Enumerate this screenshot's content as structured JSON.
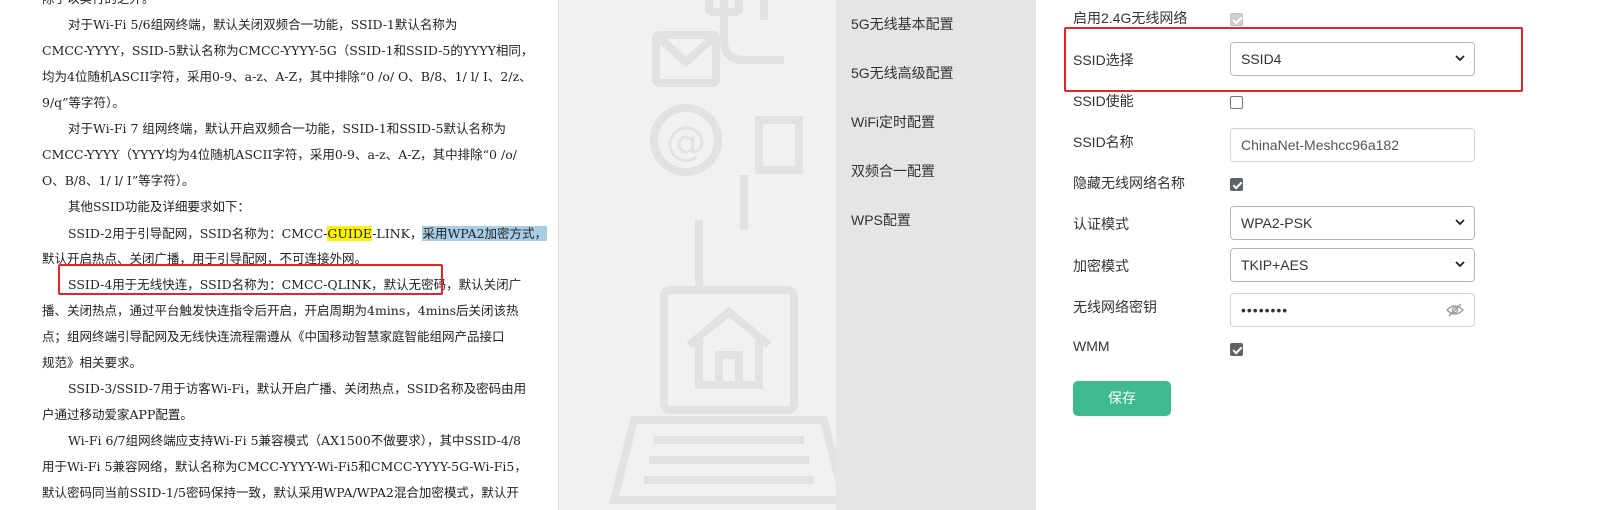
{
  "document": {
    "lines": [
      {
        "text": "除了以实行的之外。",
        "indent": false
      },
      {
        "text": "对于Wi-Fi 5/6组网终端，默认关闭双频合一功能，SSID-1默认名称为",
        "indent": true
      },
      {
        "text": "CMCC-YYYY，SSID-5默认名称为CMCC-YYYY-5G（SSID-1和SSID-5的YYYY相同，",
        "indent": false
      },
      {
        "text": "均为4位随机ASCII字符，采用0-9、a-z、A-Z，其中排除“0 /o/ O、B/8、1/ l/ I、2/z、",
        "indent": false
      },
      {
        "text": "9/q”等字符）。",
        "indent": false
      },
      {
        "text": "对于Wi-Fi 7 组网终端，默认开启双频合一功能，SSID-1和SSID-5默认名称为",
        "indent": true
      },
      {
        "text": "CMCC-YYYY（YYYY均为4位随机ASCII字符，采用0-9、a-z、A-Z，其中排除“0 /o/",
        "indent": false
      },
      {
        "text": "O、B/8、1/ l/ I”等字符）。",
        "indent": false
      },
      {
        "text": "其他SSID功能及详细要求如下：",
        "indent": true
      }
    ],
    "guide_line": {
      "prefix": "SSID-2用于引导配网，SSID名称为：CMCC-",
      "yellow": "GUIDE",
      "middle": "-LINK，",
      "blue": "采用WPA2加密方式，"
    },
    "guide_line2": "默认开启热点、关闭广播，用于引导配网，不可连接外网。",
    "qlink_line": "SSID-4用于无线快连，SSID名称为：CMCC-QLINK，默认无密码，默认关闭广",
    "lines2": [
      {
        "text": "播、关闭热点，通过平台触发快连指令后开启，开启周期为4mins，4mins后关闭该热",
        "indent": false
      },
      {
        "text": "点；组网终端引导配网及无线快连流程需遵从《中国移动智慧家庭智能组网产品接口",
        "indent": false
      },
      {
        "text": "规范》相关要求。",
        "indent": false
      },
      {
        "text": "SSID-3/SSID-7用于访客Wi-Fi，默认开启广播、关闭热点，SSID名称及密码由用",
        "indent": true
      },
      {
        "text": "户通过移动爱家APP配置。",
        "indent": false
      },
      {
        "text": "Wi-Fi 6/7组网终端应支持Wi-Fi 5兼容模式（AX1500不做要求），其中SSID-4/8",
        "indent": true
      },
      {
        "text": "用于Wi-Fi 5兼容网络，默认名称为CMCC-YYYY-Wi-Fi5和CMCC-YYYY-5G-Wi-Fi5，",
        "indent": false
      },
      {
        "text": "默认密码同当前SSID-1/5密码保持一致，默认采用WPA/WPA2混合加密模式，默认开",
        "indent": false
      }
    ]
  },
  "sidebar": {
    "items": [
      {
        "label": "5G无线基本配置"
      },
      {
        "label": "5G无线高级配置"
      },
      {
        "label": "WiFi定时配置"
      },
      {
        "label": "双频合一配置"
      },
      {
        "label": "WPS配置"
      }
    ]
  },
  "form": {
    "enable_24g": {
      "label": "启用2.4G无线网络",
      "checked": true,
      "disabled": true
    },
    "ssid_select": {
      "label": "SSID选择",
      "value": "SSID4"
    },
    "ssid_enable": {
      "label": "SSID使能",
      "checked": false
    },
    "ssid_name": {
      "label": "SSID名称",
      "value": "ChinaNet-Meshcc96a182"
    },
    "hide_ssid": {
      "label": "隐藏无线网络名称",
      "checked": true
    },
    "auth_mode": {
      "label": "认证模式",
      "value": "WPA2-PSK"
    },
    "encrypt_mode": {
      "label": "加密模式",
      "value": "TKIP+AES"
    },
    "wifi_key": {
      "label": "无线网络密钥",
      "value": "••••••••"
    },
    "wmm": {
      "label": "WMM",
      "checked": true
    },
    "save_label": "保存"
  },
  "colors": {
    "accent_green": "#3dba8e",
    "highlight_red": "#e0262b",
    "highlight_yellow": "#fff200",
    "highlight_blue": "#a8cde6"
  },
  "icons": [
    "chevron-down-icon",
    "eye-slash-icon",
    "checkmark-icon"
  ]
}
